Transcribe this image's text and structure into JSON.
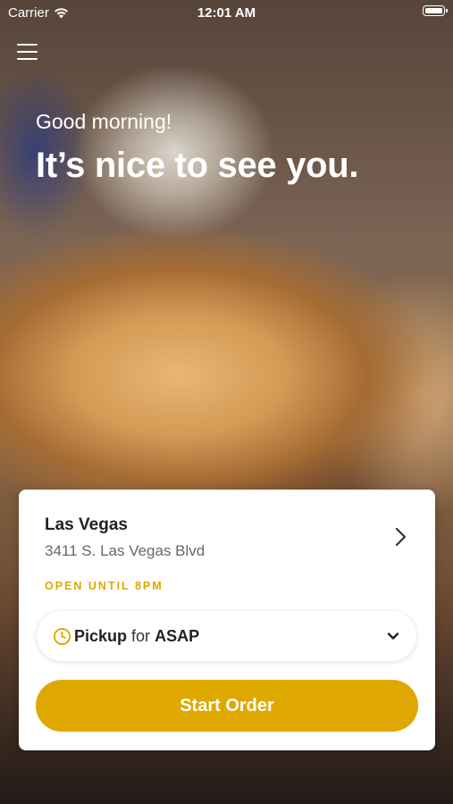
{
  "status_bar": {
    "carrier": "Carrier",
    "time": "12:01 AM"
  },
  "header": {
    "greeting": "Good morning!",
    "headline": "It’s nice to see you."
  },
  "location": {
    "name": "Las Vegas",
    "address": "3411 S. Las Vegas Blvd",
    "hours": "OPEN UNTIL 8PM"
  },
  "order_mode": {
    "mode": "Pickup",
    "connector": "for",
    "time": "ASAP"
  },
  "actions": {
    "start_order": "Start Order"
  },
  "colors": {
    "accent": "#dea800",
    "hours_text": "#dca800"
  }
}
